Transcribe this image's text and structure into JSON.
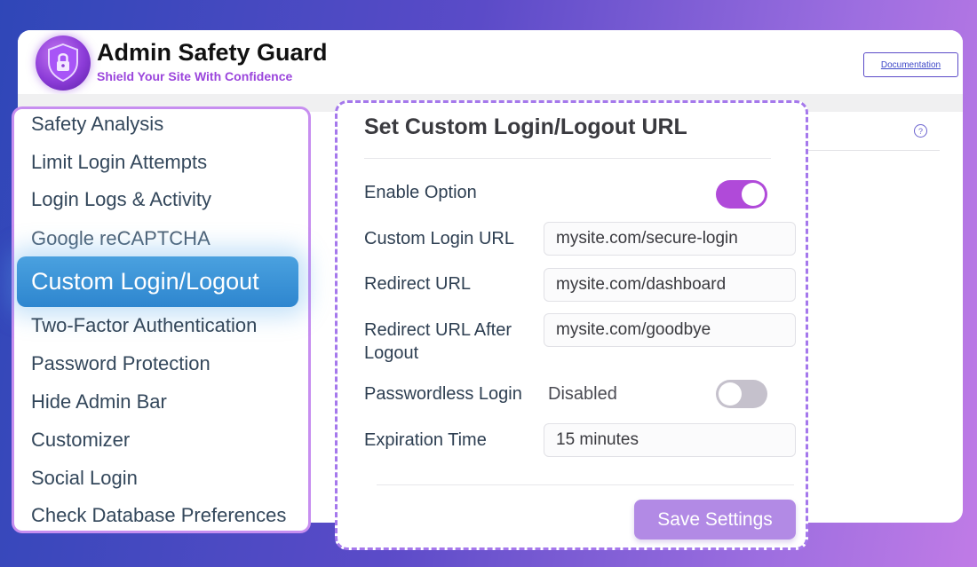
{
  "header": {
    "title": "Admin Safety Guard",
    "tagline": "Shield Your Site With Confidence",
    "doc_button": "Documentation",
    "help_icon": "help-circle-icon",
    "help_glyph": "?"
  },
  "sidebar": {
    "items": [
      "Safety Analysis",
      "Limit Login Attempts",
      "Login Logs & Activity",
      "Google reCAPTCHA",
      "Custom Login/Logout",
      "Two-Factor Authentication",
      "Password Protection",
      "Hide Admin Bar",
      "Customizer",
      "Social Login",
      "Check Database Preferences"
    ],
    "active_index": 4
  },
  "panel": {
    "title": "Set Custom Login/Logout URL",
    "enable_option": {
      "label": "Enable Option",
      "state": "on"
    },
    "custom_login_url": {
      "label": "Custom Login URL",
      "value": "mysite.com/secure-login"
    },
    "redirect_url": {
      "label": "Redirect URL",
      "value": "mysite.com/dashboard"
    },
    "redirect_after_logout": {
      "label_line1": "Redirect URL After",
      "label_line2": "Logout",
      "value": "mysite.com/goodbye"
    },
    "passwordless_login": {
      "label": "Passwordless Login",
      "status": "Disabled",
      "state": "off"
    },
    "expiration_time": {
      "label": "Expiration Time",
      "value": "15 minutes"
    },
    "save_button": "Save Settings"
  },
  "colors": {
    "accent_purple": "#b04ad9",
    "active_blue": "#2e86cf",
    "save_button": "#b28ae5",
    "tagline": "#9b46dc"
  }
}
